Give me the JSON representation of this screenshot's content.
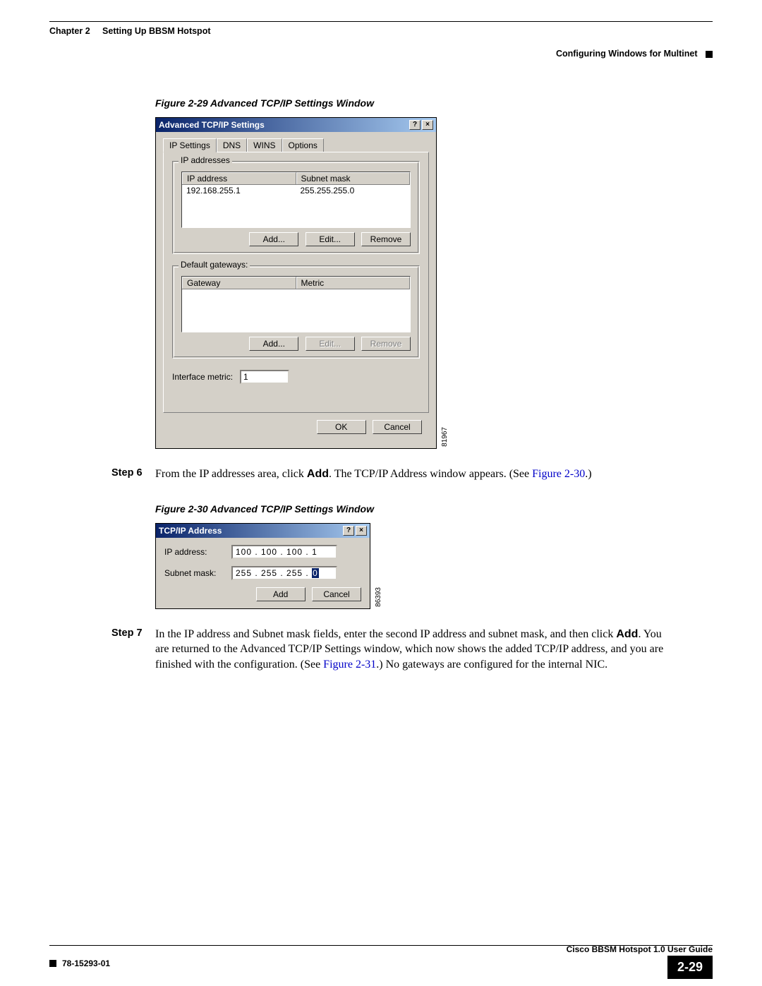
{
  "header": {
    "chapter": "Chapter 2",
    "title": "Setting Up BBSM Hotspot",
    "section": "Configuring Windows for Multinet"
  },
  "figure1": {
    "caption": "Figure 2-29   Advanced TCP/IP Settings Window",
    "dialog_title": "Advanced TCP/IP Settings",
    "tabs": [
      "IP Settings",
      "DNS",
      "WINS",
      "Options"
    ],
    "ip_group": {
      "legend": "IP addresses",
      "headers": [
        "IP address",
        "Subnet mask"
      ],
      "rows": [
        [
          "192.168.255.1",
          "255.255.255.0"
        ]
      ],
      "buttons": [
        "Add...",
        "Edit...",
        "Remove"
      ]
    },
    "gw_group": {
      "legend": "Default gateways:",
      "headers": [
        "Gateway",
        "Metric"
      ],
      "rows": [],
      "buttons": [
        "Add...",
        "Edit...",
        "Remove"
      ]
    },
    "metric_label": "Interface metric:",
    "metric_value": "1",
    "ok": "OK",
    "cancel": "Cancel",
    "side_id": "81967"
  },
  "step6": {
    "label": "Step 6",
    "pre": "From the IP addresses area, click ",
    "bold": "Add",
    "post1": ". The TCP/IP Address window appears. (See ",
    "link": "Figure 2-30",
    "post2": ".)"
  },
  "figure2": {
    "caption": "Figure 2-30   Advanced TCP/IP Settings Window",
    "dialog_title": "TCP/IP Address",
    "ip_label": "IP address:",
    "ip_value": "100 . 100 . 100 .   1",
    "mask_label": "Subnet mask:",
    "mask_prefix": "255 . 255 . 255 . ",
    "mask_sel": "0",
    "add": "Add",
    "cancel": "Cancel",
    "side_id": "86393"
  },
  "step7": {
    "label": "Step 7",
    "t1": "In the IP address and Subnet mask fields, enter the second IP address and subnet mask, and then click ",
    "b1": "Add",
    "t2": ". You are returned to the Advanced TCP/IP Settings window, which now shows the added TCP/IP address, and you are finished with the configuration. (See ",
    "link": "Figure 2-31",
    "t3": ".) No gateways are configured for the internal NIC."
  },
  "footer": {
    "guide": "Cisco BBSM Hotspot 1.0 User Guide",
    "docnum": "78-15293-01",
    "pagenum": "2-29"
  }
}
